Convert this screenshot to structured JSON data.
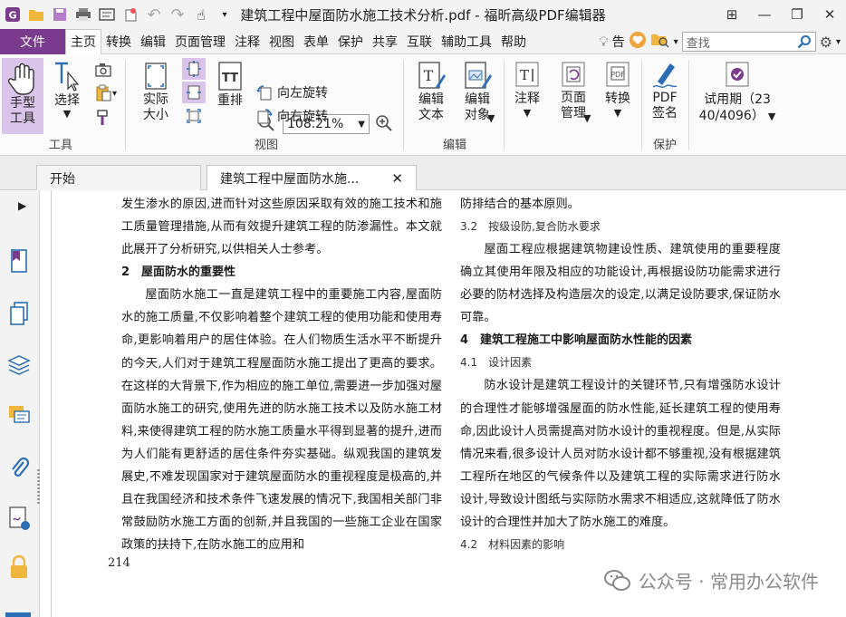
{
  "window": {
    "title": "建筑工程中屋面防水施工技术分析.pdf - 福昕高级PDF编辑器"
  },
  "menu": {
    "file": "文件",
    "items": [
      "主页",
      "转换",
      "编辑",
      "页面管理",
      "注释",
      "视图",
      "表单",
      "保护",
      "共享",
      "互联",
      "辅助工具",
      "帮助"
    ],
    "extra": "告",
    "search_placeholder": "查找"
  },
  "ribbon": {
    "hand_tool": "手型工具",
    "select": "选择",
    "group_tools": "工具",
    "actual_size": "实际大小",
    "reflow": "重排",
    "zoom_value": "108.21%",
    "rotate_left": "向左旋转",
    "rotate_right": "向右旋转",
    "group_view": "视图",
    "edit_text": "编辑文本",
    "edit_object": "编辑对象",
    "group_edit": "编辑",
    "comment": "注释",
    "page_manage": "页面管理",
    "convert": "转换",
    "pdf_sign": "PDF签名",
    "group_protect": "保护",
    "trial": "试用期（23",
    "trial2": "40/4096）"
  },
  "tabs": {
    "start": "开始",
    "document": "建筑工程中屋面防水施..."
  },
  "document": {
    "left": {
      "p1": "发生渗水的原因,进而针对这些原因采取有效的施工技术和施工质量管理措施,从而有效提升建筑工程的防渗漏性。本文就此展开了分析研究,以供相关人士参考。",
      "h2": "2　屋面防水的重要性",
      "p2": "屋面防水施工一直是建筑工程中的重要施工内容,屋面防水的施工质量,不仅影响着整个建筑工程的使用功能和使用寿命,更影响着用户的居住体验。在人们物质生活水平不断提升的今天,人们对于建筑工程屋面防水施工提出了更高的要求。在这样的大背景下,作为相应的施工单位,需要进一步加强对屋面防水施工的研究,使用先进的防水施工技术以及防水施工材料,来使得建筑工程的防水施工质量水平得到显著的提升,进而为人们能有更舒适的居住条件夯实基础。纵观我国的建筑发展史,不难发现国家对于建筑屋面防水的重视程度是极高的,并且在我国经济和技术条件飞速发展的情况下,我国相关部门非常鼓励防水施工方面的创新,并且我国的一些施工企业在国家政策的扶持下,在防水施工的应用和",
      "page_number": "214"
    },
    "right": {
      "p0": "防排结合的基本原则。",
      "h32": "3.2　按级设防,复合防水要求",
      "p1": "屋面工程应根据建筑物建设性质、建筑使用的重要程度确立其使用年限及相应的功能设计,再根据设防功能需求进行必要的防材选择及构造层次的设定,以满足设防要求,保证防水可靠。",
      "h4": "4　建筑工程施工中影响屋面防水性能的因素",
      "h41": "4.1　设计因素",
      "p2": "防水设计是建筑工程设计的关键环节,只有增强防水设计的合理性才能够增强屋面的防水性能,延长建筑工程的使用寿命,因此设计人员需提高对防水设计的重视程度。但是,从实际情况来看,很多设计人员对防水设计都不够重视,没有根据建筑工程所在地区的气候条件以及建筑工程的实际需求进行防水设计,导致设计图纸与实际防水需求不相适应,这就降低了防水设计的合理性并加大了防水施工的难度。",
      "h42": "4.2　材料因素的影响"
    },
    "watermark": "公众号 · 常用办公软件"
  },
  "colors": {
    "accent": "#7a3b8f",
    "selected": "#dbc4ea"
  }
}
